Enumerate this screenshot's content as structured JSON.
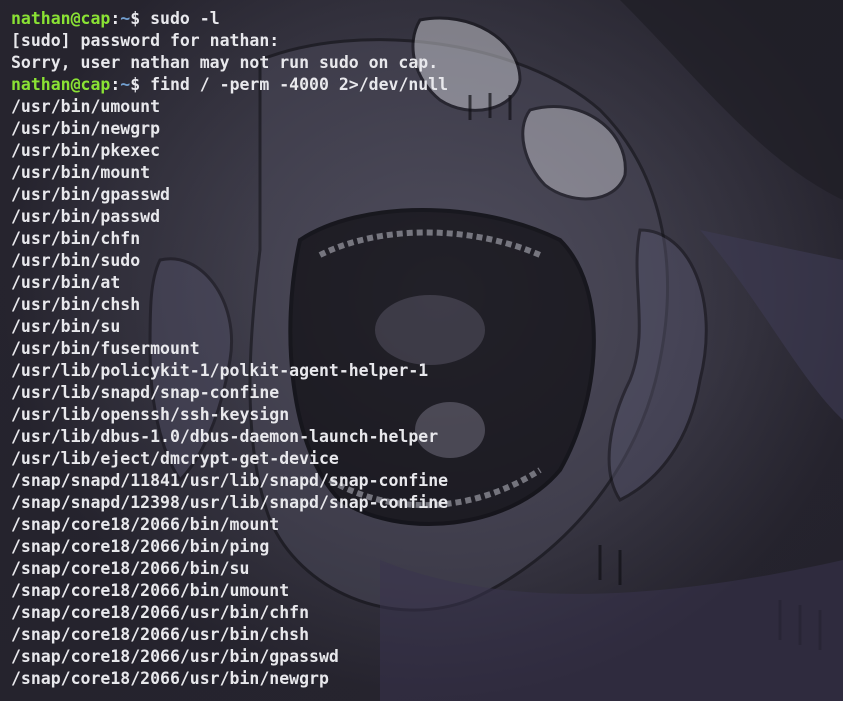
{
  "colors": {
    "prompt_user": "#8ae234",
    "prompt_dir": "#729fcf",
    "text": "#e8e8ec"
  },
  "prompt1": {
    "user_host": "nathan@cap",
    "sep": ":",
    "dir": "~",
    "sign": "$ ",
    "command": "sudo -l"
  },
  "messages": {
    "password_prompt": "[sudo] password for nathan:",
    "sorry": "Sorry, user nathan may not run sudo on cap."
  },
  "prompt2": {
    "user_host": "nathan@cap",
    "sep": ":",
    "dir": "~",
    "sign": "$ ",
    "command": "find / -perm -4000 2>/dev/null"
  },
  "results": [
    "/usr/bin/umount",
    "/usr/bin/newgrp",
    "/usr/bin/pkexec",
    "/usr/bin/mount",
    "/usr/bin/gpasswd",
    "/usr/bin/passwd",
    "/usr/bin/chfn",
    "/usr/bin/sudo",
    "/usr/bin/at",
    "/usr/bin/chsh",
    "/usr/bin/su",
    "/usr/bin/fusermount",
    "/usr/lib/policykit-1/polkit-agent-helper-1",
    "/usr/lib/snapd/snap-confine",
    "/usr/lib/openssh/ssh-keysign",
    "/usr/lib/dbus-1.0/dbus-daemon-launch-helper",
    "/usr/lib/eject/dmcrypt-get-device",
    "/snap/snapd/11841/usr/lib/snapd/snap-confine",
    "/snap/snapd/12398/usr/lib/snapd/snap-confine",
    "/snap/core18/2066/bin/mount",
    "/snap/core18/2066/bin/ping",
    "/snap/core18/2066/bin/su",
    "/snap/core18/2066/bin/umount",
    "/snap/core18/2066/usr/bin/chfn",
    "/snap/core18/2066/usr/bin/chsh",
    "/snap/core18/2066/usr/bin/gpasswd",
    "/snap/core18/2066/usr/bin/newgrp"
  ]
}
